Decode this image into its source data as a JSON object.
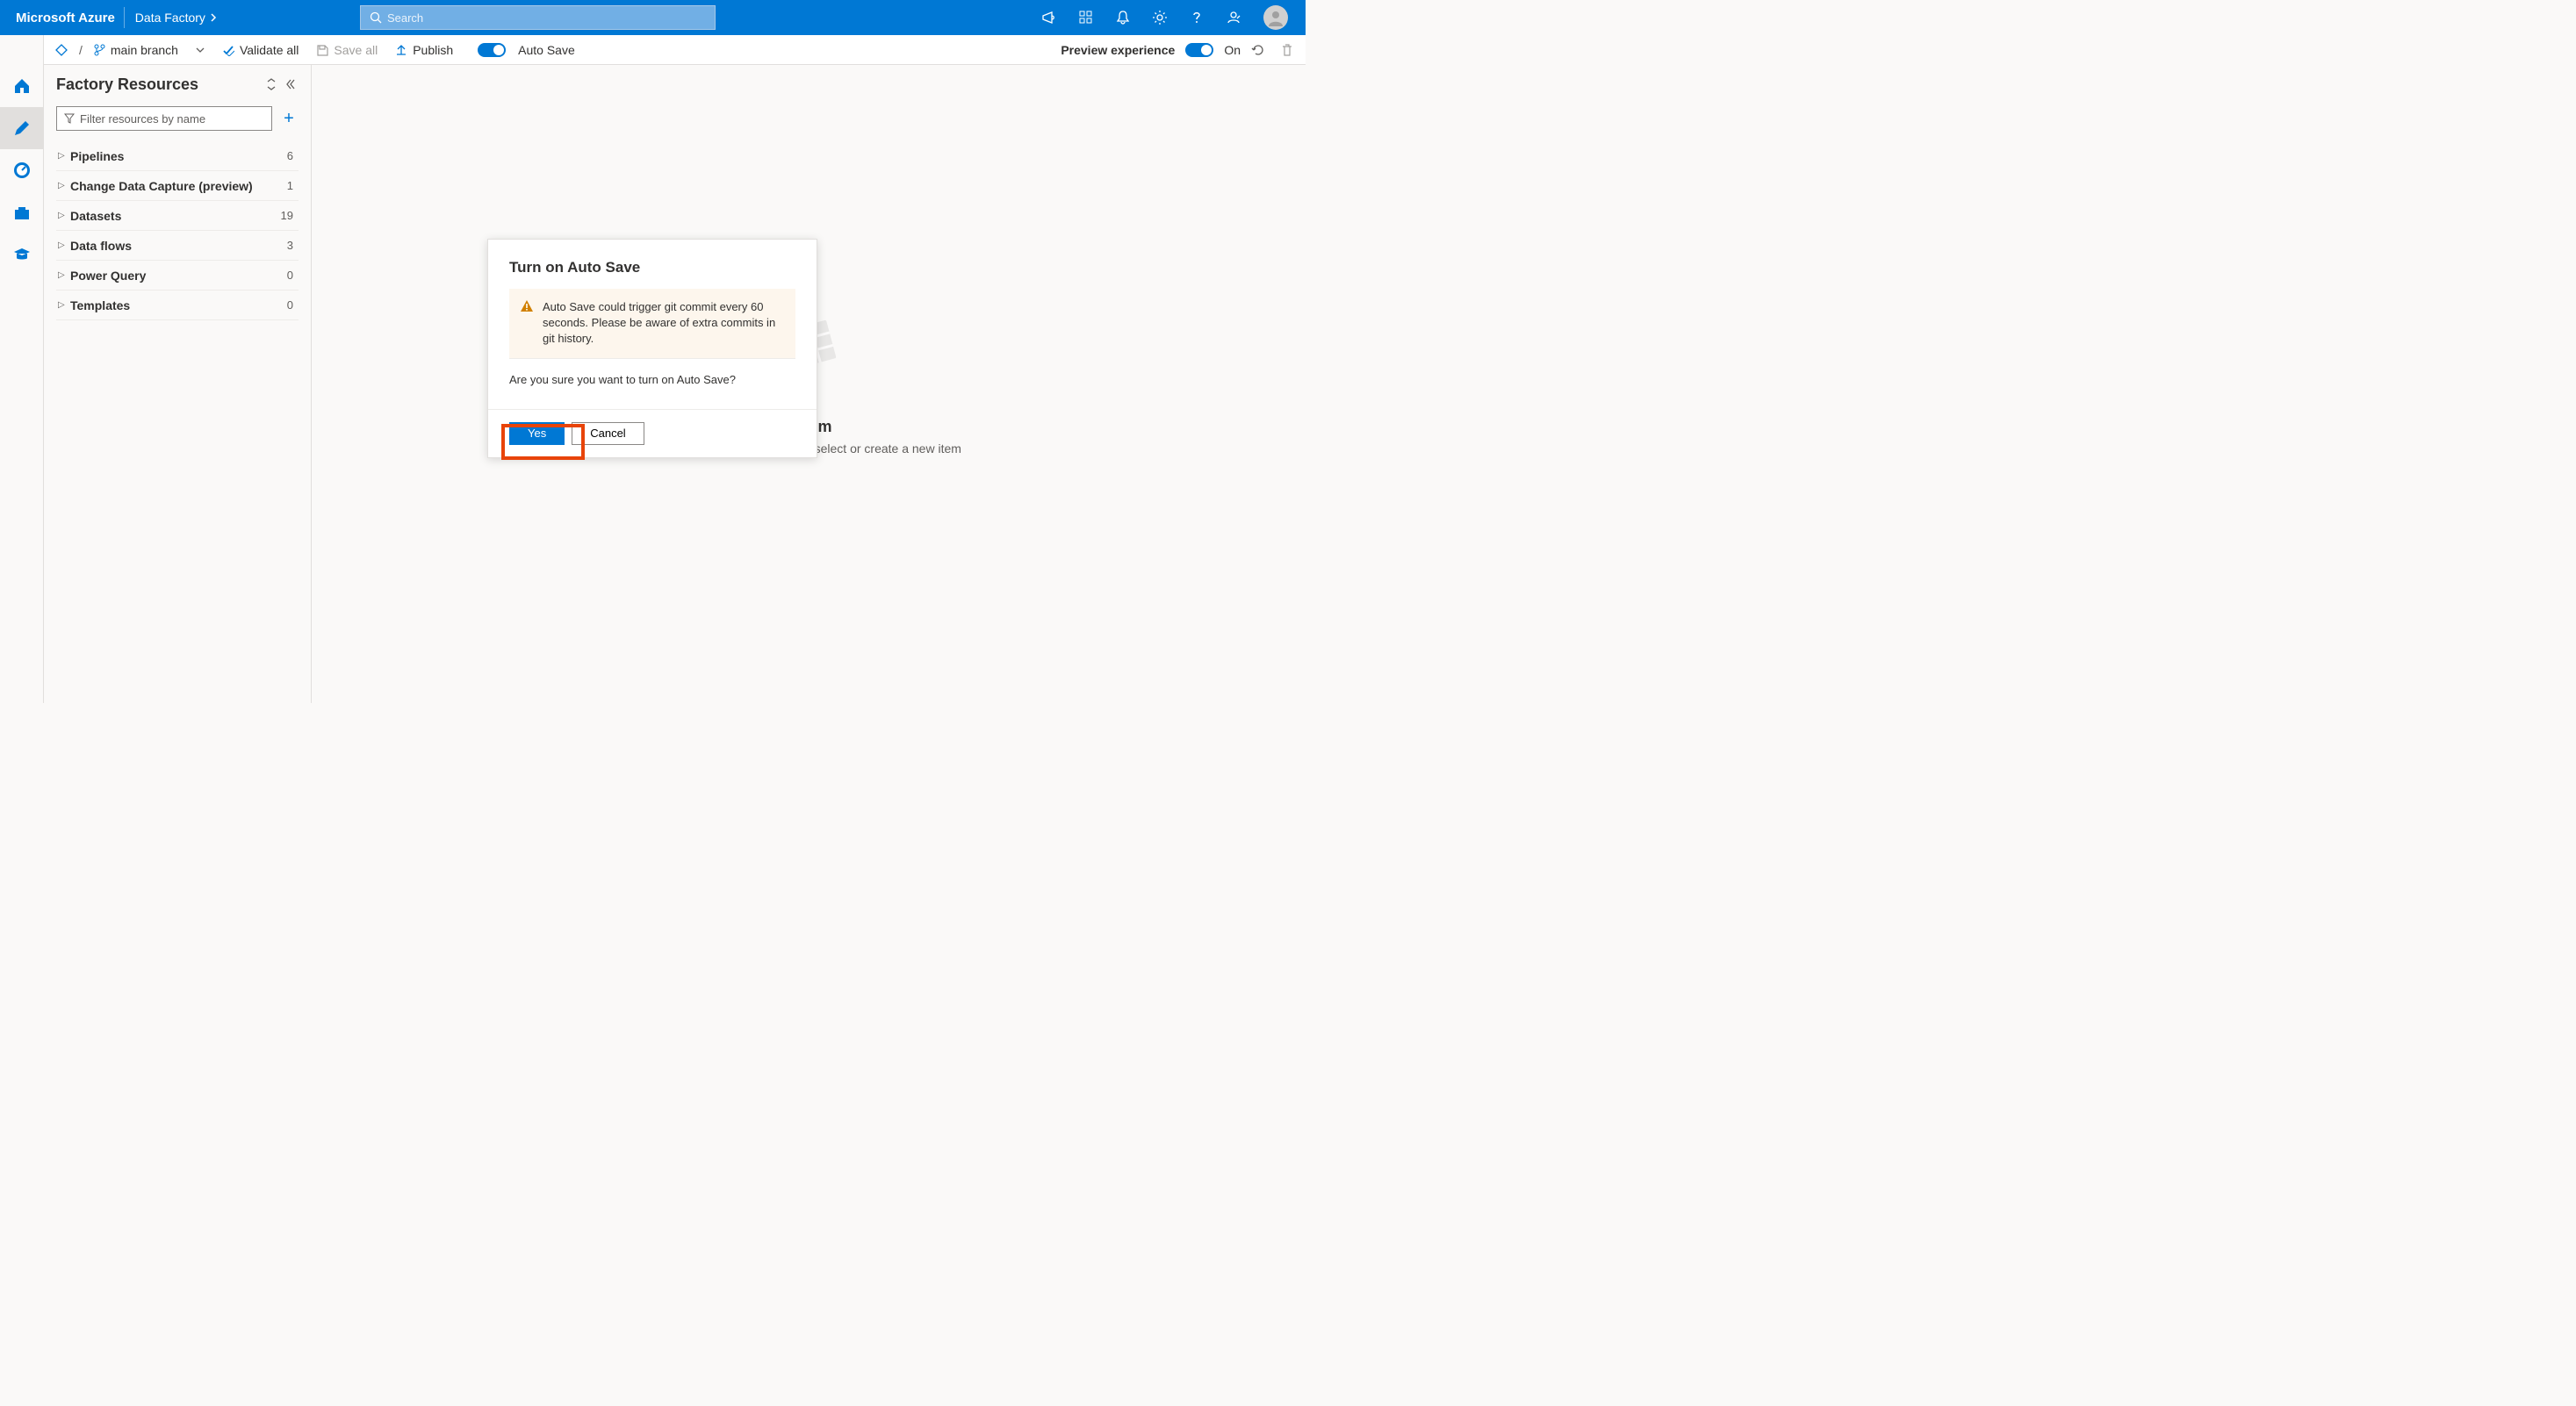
{
  "header": {
    "brand": "Microsoft Azure",
    "breadcrumb": "Data Factory",
    "search_placeholder": "Search"
  },
  "toolbar": {
    "branch": "main branch",
    "validate": "Validate all",
    "save": "Save all",
    "publish": "Publish",
    "autosave": "Auto Save",
    "preview": "Preview experience",
    "preview_state": "On"
  },
  "sidebar": {
    "title": "Factory Resources",
    "filter_placeholder": "Filter resources by name",
    "items": [
      {
        "label": "Pipelines",
        "count": "6"
      },
      {
        "label": "Change Data Capture (preview)",
        "count": "1"
      },
      {
        "label": "Datasets",
        "count": "19"
      },
      {
        "label": "Data flows",
        "count": "3"
      },
      {
        "label": "Power Query",
        "count": "0"
      },
      {
        "label": "Templates",
        "count": "0"
      }
    ]
  },
  "canvas": {
    "empty_title_suffix": "item",
    "empty_sub": "Use the resource explorer to select or create a new item"
  },
  "dialog": {
    "title": "Turn on Auto Save",
    "warning": "Auto Save could trigger git commit every 60 seconds. Please be aware of extra commits in git history.",
    "question": "Are you sure you want to turn on Auto Save?",
    "yes": "Yes",
    "cancel": "Cancel"
  }
}
